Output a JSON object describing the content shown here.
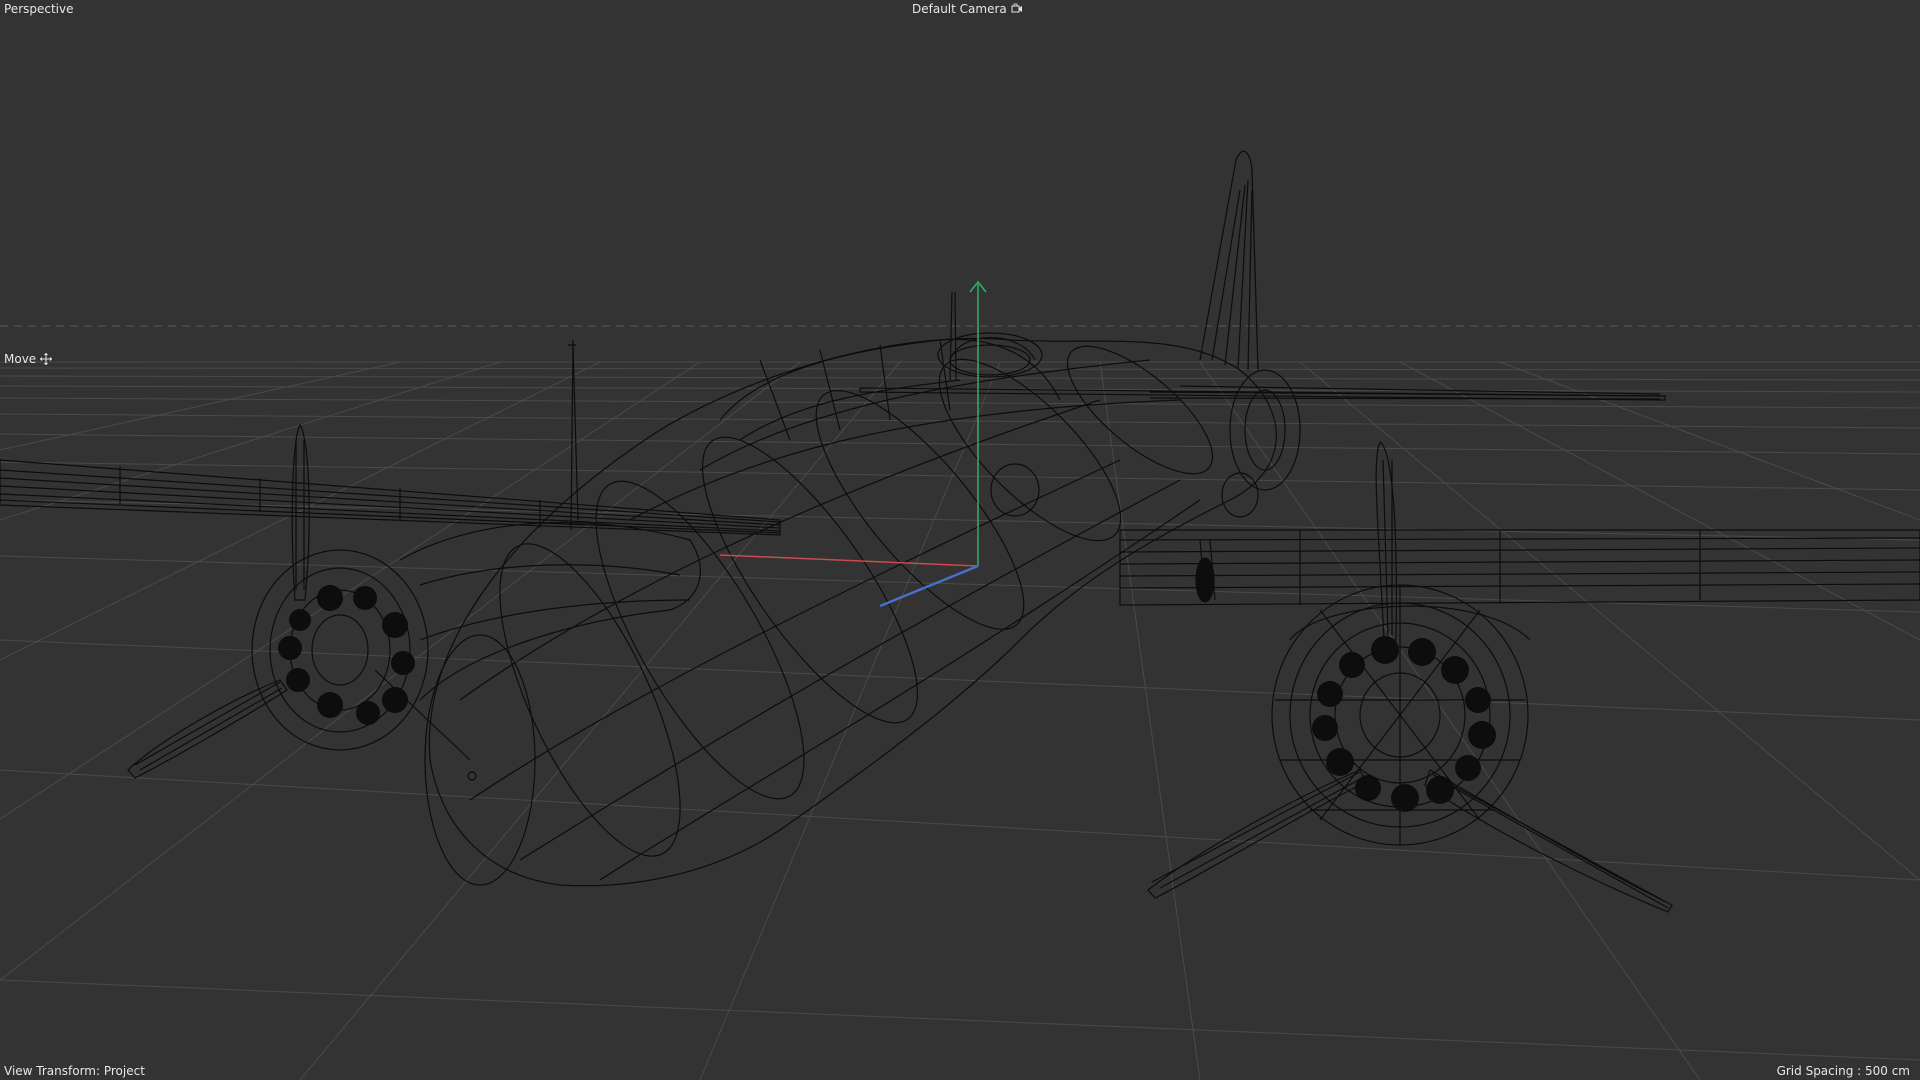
{
  "viewport": {
    "projection_label": "Perspective",
    "camera_label": "Default Camera",
    "camera_icon": "camera-icon",
    "active_tool_label": "Move",
    "active_tool_icon": "move-icon",
    "view_transform_label": "View Transform: Project",
    "grid_spacing_label": "Grid Spacing : 500 cm"
  },
  "colors": {
    "viewport_bg": "#333333",
    "grid_line": "#4a4a4a",
    "horizon_line": "#5a5a5a",
    "wireframe": "#0d0d0d",
    "axis_x": "#c84b4b",
    "axis_y": "#2fae6f",
    "axis_z": "#4a6fc8",
    "hud_text": "#e6e6e6"
  }
}
